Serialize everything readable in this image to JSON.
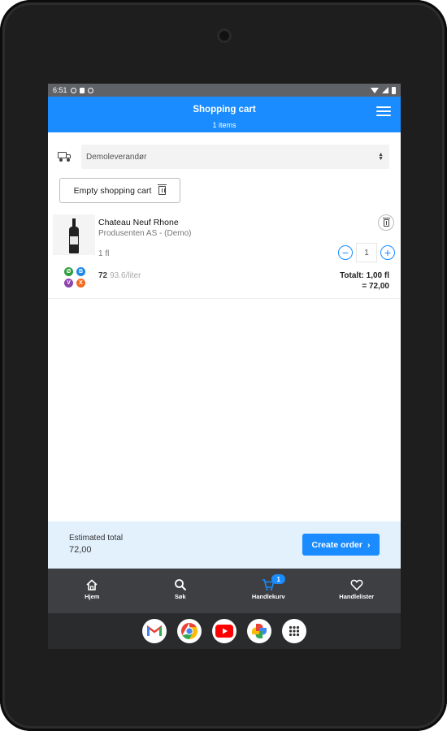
{
  "status": {
    "time": "6:51"
  },
  "header": {
    "title": "Shopping cart",
    "subtitle": "1 items"
  },
  "supplier": {
    "selected": "Demoleverandør"
  },
  "actions": {
    "empty_cart": "Empty shopping cart"
  },
  "cart": {
    "items": [
      {
        "name": "Chateau Neuf Rhone",
        "producer": "Produsenten AS - (Demo)",
        "unit": "1 fl",
        "quantity": "1",
        "price": "72",
        "price_per_liter": "93.6/liter",
        "total_line1": "Totalt: 1,00 fl",
        "total_line2": "= 72,00",
        "badges": [
          {
            "letter": "Ø",
            "color": "#2e9e3e"
          },
          {
            "letter": "B",
            "color": "#1e88e5"
          },
          {
            "letter": "V",
            "color": "#8e44ad"
          },
          {
            "letter": "X",
            "color": "#f26b21"
          }
        ]
      }
    ]
  },
  "footer": {
    "estimate_label": "Estimated total",
    "estimate_value": "72,00",
    "create_order": "Create order"
  },
  "nav": {
    "items": [
      {
        "label": "Hjem",
        "icon": "home-icon"
      },
      {
        "label": "Søk",
        "icon": "search-icon"
      },
      {
        "label": "Handlekurv",
        "icon": "cart-icon",
        "badge": "1"
      },
      {
        "label": "Handlelister",
        "icon": "heart-icon"
      }
    ]
  },
  "dock": {
    "apps": [
      "gmail-icon",
      "chrome-icon",
      "youtube-icon",
      "photos-icon",
      "apps-grid-icon"
    ]
  },
  "colors": {
    "accent": "#1a8cff",
    "estimate_bg": "#e3f1fd",
    "nav_bg": "#3d3f42"
  }
}
